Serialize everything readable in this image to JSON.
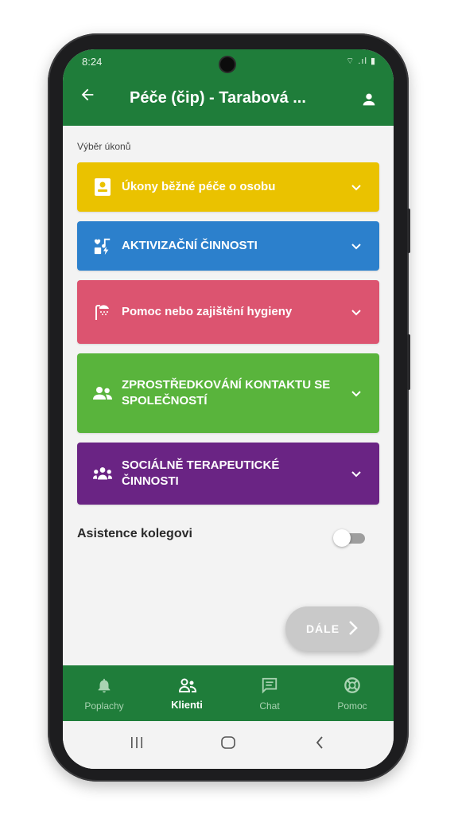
{
  "status": {
    "time": "8:24",
    "indicators": "⌔ .ıl ▮"
  },
  "header": {
    "back_icon": "arrow-left-icon",
    "title": "Péče (čip) - Tarabová ...",
    "profile_icon": "person-icon"
  },
  "section": {
    "label": "Výběr úkonů"
  },
  "categories": [
    {
      "label": "Úkony běžné péče o osobu",
      "color": "#eac200",
      "icon": "person-badge-icon"
    },
    {
      "label": "AKTIVIZAČNÍ ČINNOSTI",
      "color": "#2c80cc",
      "icon": "activities-icon"
    },
    {
      "label": "Pomoc nebo zajištění hygieny",
      "color": "#dc5470",
      "icon": "shower-icon"
    },
    {
      "label": "ZPROSTŘEDKOVÁNÍ KONTAKTU SE SPOLEČNOSTÍ",
      "color": "#59b43c",
      "icon": "users-icon"
    },
    {
      "label": "SOCIÁLNĚ TERAPEUTICKÉ ČINNOSTI",
      "color": "#6a2484",
      "icon": "group-icon"
    }
  ],
  "assist": {
    "label": "Asistence kolegovi",
    "enabled": false
  },
  "next": {
    "label": "DÁLE"
  },
  "nav": [
    {
      "label": "Poplachy",
      "icon": "bell-icon",
      "active": false
    },
    {
      "label": "Klienti",
      "icon": "clients-icon",
      "active": true
    },
    {
      "label": "Chat",
      "icon": "chat-icon",
      "active": false
    },
    {
      "label": "Pomoc",
      "icon": "lifebuoy-icon",
      "active": false
    }
  ],
  "colors": {
    "primary": "#1f7d3a",
    "background": "#f3f3f3"
  }
}
